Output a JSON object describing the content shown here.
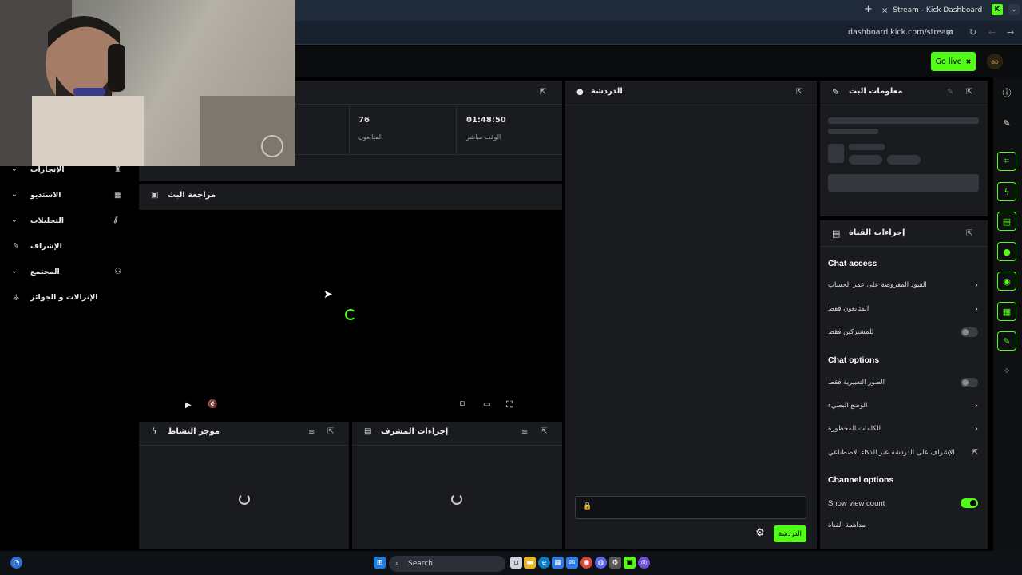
{
  "browser": {
    "tab_title": "Stream - Kick Dashboard",
    "new_tab": "+",
    "tab_close": "×",
    "tab_logo": "K",
    "url": "dashboard.kick.com/stream",
    "back": "←",
    "forward": "→",
    "reload": "↻",
    "tune": "⇄"
  },
  "appbar": {
    "go_live": "Go live",
    "go_live_icon": "✖",
    "avatar_text": "ꩧ"
  },
  "stats": [
    {
      "value": "01:48:50",
      "label": "الوقت مباشر"
    },
    {
      "value": "76",
      "label": "المتابعون"
    }
  ],
  "sidebar": {
    "items": [
      {
        "label": "الإنجازات",
        "icon": "trophy-icon",
        "glyph": "♜"
      },
      {
        "label": "الاستديو",
        "icon": "studio-icon",
        "glyph": "▦"
      },
      {
        "label": "التحليلات",
        "icon": "analytics-icon",
        "glyph": "⫽"
      },
      {
        "label": "الإشراف",
        "icon": "wrench-icon",
        "glyph": "✎"
      },
      {
        "label": "المجتمع",
        "icon": "community-icon",
        "glyph": "⚇"
      },
      {
        "label": "الإنزالات و الجوائز",
        "icon": "drops-icon",
        "glyph": "⚶"
      }
    ],
    "chevron": "⌄"
  },
  "preview": {
    "title": "مراجعة البث",
    "icon": "preview-icon"
  },
  "activity": {
    "title": "موجز النشاط"
  },
  "mod_actions": {
    "title": "إجراءات المشرف"
  },
  "chat": {
    "title": "الدردشة",
    "input_placeholder": "",
    "send_label": "الدردشة",
    "lock": "🔒",
    "gear": "⚙"
  },
  "stream_info": {
    "title": "معلومات البث"
  },
  "channel_actions": {
    "title": "إجراءات القناة",
    "chat_access": {
      "heading": "Chat access",
      "rows": [
        {
          "label": "القيود المفروضة على عمر الحساب",
          "kind": "chevron"
        },
        {
          "label": "المتابعون فقط",
          "kind": "chevron"
        },
        {
          "label": "للمشتركين فقط",
          "kind": "toggle",
          "on": false
        }
      ]
    },
    "chat_options": {
      "heading": "Chat options",
      "rows": [
        {
          "label": "الصور التعبيرية فقط",
          "kind": "toggle",
          "on": false
        },
        {
          "label": "الوضع البطيء",
          "kind": "chevron"
        },
        {
          "label": "الكلمات المحظورة",
          "kind": "chevron"
        },
        {
          "label": "الإشراف على الدردشة عبر الذكاء الاصطناعي",
          "kind": "external"
        }
      ]
    },
    "channel_options": {
      "heading": "Channel options",
      "rows": [
        {
          "label": "Show view count",
          "kind": "toggle",
          "on": true
        },
        {
          "label": "مداهمة القناة",
          "kind": "none"
        }
      ]
    }
  },
  "player": {
    "play": "▶",
    "mute": "🔇",
    "pip": "⧉",
    "theater": "▭",
    "fullscreen": "⛶"
  },
  "taskbar": {
    "search_placeholder": "Search"
  },
  "colors": {
    "accent": "#53fc18",
    "panel": "#191b1f",
    "bg": "#000000"
  }
}
